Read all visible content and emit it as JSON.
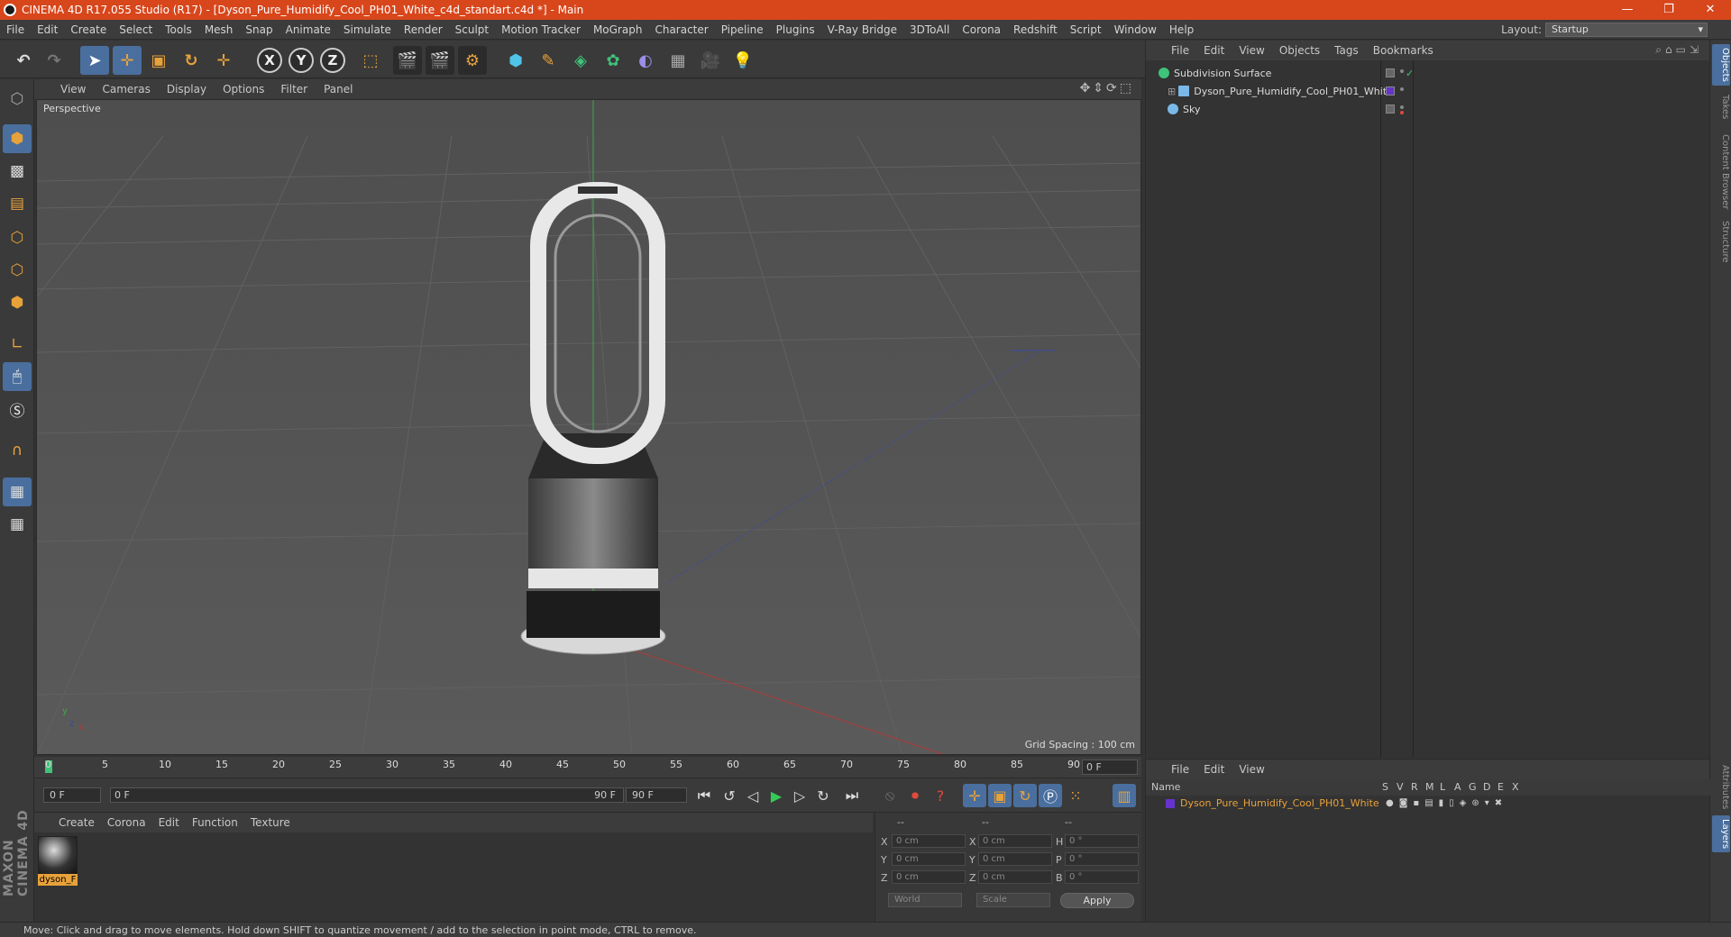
{
  "window": {
    "title": "CINEMA 4D R17.055 Studio (R17) - [Dyson_Pure_Humidify_Cool_PH01_White_c4d_standart.c4d *] - Main",
    "minimize": "—",
    "restore": "❐",
    "close": "✕"
  },
  "menu": [
    "File",
    "Edit",
    "Create",
    "Select",
    "Tools",
    "Mesh",
    "Snap",
    "Animate",
    "Simulate",
    "Render",
    "Sculpt",
    "Motion Tracker",
    "MoGraph",
    "Character",
    "Pipeline",
    "Plugins",
    "V-Ray Bridge",
    "3DToAll",
    "Corona",
    "Redshift",
    "Script",
    "Window",
    "Help"
  ],
  "layout": {
    "label": "Layout:",
    "value": "Startup"
  },
  "toolbar": {
    "x": "X",
    "y": "Y",
    "z": "Z"
  },
  "viewport": {
    "menu": [
      "View",
      "Cameras",
      "Display",
      "Options",
      "Filter",
      "Panel"
    ],
    "label": "Perspective",
    "grid_spacing": "Grid Spacing : 100 cm",
    "axis_y": "y",
    "axis_z": "z",
    "axis_x": "x"
  },
  "timeline": {
    "ticks": [
      "0",
      "5",
      "10",
      "15",
      "20",
      "25",
      "30",
      "35",
      "40",
      "45",
      "50",
      "55",
      "60",
      "65",
      "70",
      "75",
      "80",
      "85",
      "90"
    ],
    "current_frame": "0 F"
  },
  "transport": {
    "start": "0 F",
    "range_start": "0 F",
    "range_end": "90 F",
    "end": "90 F"
  },
  "materials": {
    "menu": [
      "Create",
      "Corona",
      "Edit",
      "Function",
      "Texture"
    ],
    "items": [
      {
        "name": "dyson_F"
      }
    ]
  },
  "coords": {
    "headers": [
      "--",
      "--",
      "--"
    ],
    "rows": [
      {
        "a": "X",
        "av": "0 cm",
        "b": "X",
        "bv": "0 cm",
        "c": "H",
        "cv": "0 °"
      },
      {
        "a": "Y",
        "av": "0 cm",
        "b": "Y",
        "bv": "0 cm",
        "c": "P",
        "cv": "0 °"
      },
      {
        "a": "Z",
        "av": "0 cm",
        "b": "Z",
        "bv": "0 cm",
        "c": "B",
        "cv": "0 °"
      }
    ],
    "mode": "World",
    "size_mode": "Scale",
    "apply": "Apply"
  },
  "status": "Move: Click and drag to move elements. Hold down SHIFT to quantize movement / add to the selection in point mode, CTRL to remove.",
  "objects": {
    "menu": [
      "File",
      "Edit",
      "View",
      "Objects",
      "Tags",
      "Bookmarks"
    ],
    "items": [
      {
        "name": "Subdivision Surface",
        "icon_color": "#3fc27a"
      },
      {
        "name": "Dyson_Pure_Humidify_Cool_PH01_White",
        "icon_color": "#7ab8e8"
      },
      {
        "name": "Sky",
        "icon_color": "#7ab8e8"
      }
    ]
  },
  "side_tabs": [
    "Objects",
    "Takes",
    "Content Browser",
    "Structure"
  ],
  "side_tabs_bottom": [
    "Attributes",
    "Layers"
  ],
  "layers": {
    "menu": [
      "File",
      "Edit",
      "View"
    ],
    "columns": {
      "name": "Name",
      "flags": [
        "S",
        "V",
        "R",
        "M",
        "L",
        "A",
        "G",
        "D",
        "E",
        "X"
      ]
    },
    "items": [
      {
        "name": "Dyson_Pure_Humidify_Cool_PH01_White",
        "color": "#6633cc"
      }
    ]
  },
  "brand": "MAXON CINEMA 4D",
  "colors": {
    "accent": "#d8461b",
    "selected": "#4a6f9e",
    "highlight": "#e8a23a"
  }
}
